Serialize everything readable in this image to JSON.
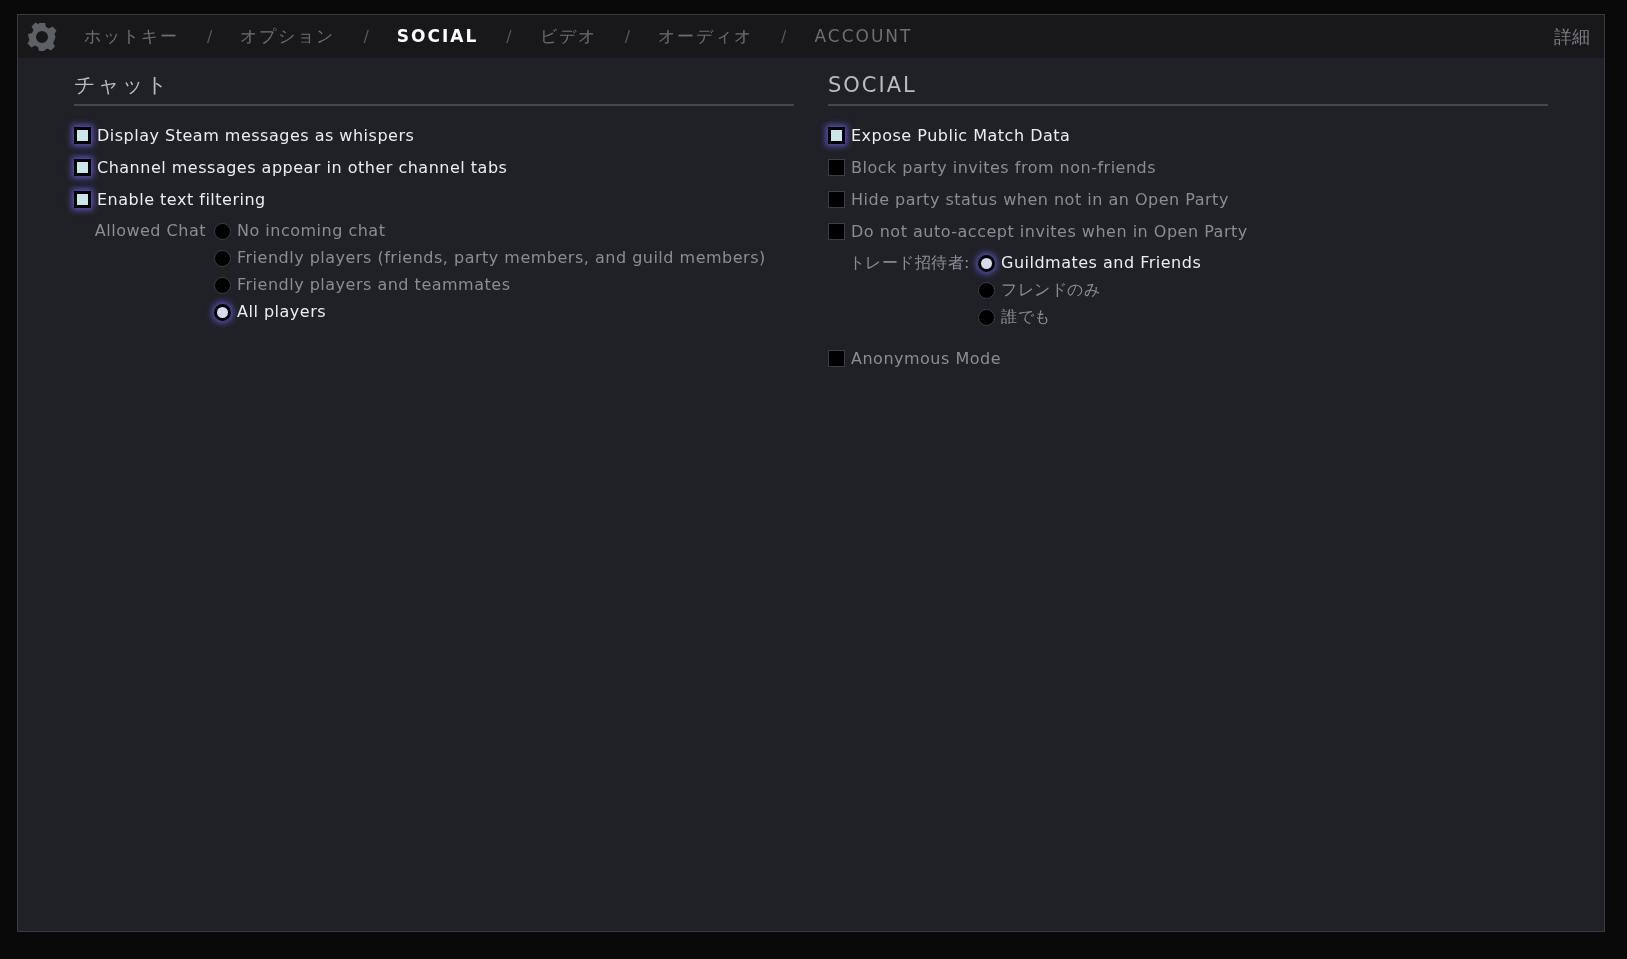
{
  "tabs": [
    {
      "label": "ホットキー",
      "selected": false
    },
    {
      "separator": "/",
      "label": "オプション",
      "selected": false
    },
    {
      "separator": "/",
      "label": "SOCIAL",
      "selected": true
    },
    {
      "separator": "/",
      "label": "ビデオ",
      "selected": false
    },
    {
      "separator": "/",
      "label": "オーディオ",
      "selected": false
    },
    {
      "separator": "/",
      "label": "ACCOUNT",
      "selected": false
    }
  ],
  "advanced_link": "詳細",
  "sections": [
    {
      "title": "チャット",
      "items": [
        {
          "kind": "checkbox",
          "label": "Display Steam messages as whispers",
          "checked": true
        },
        {
          "kind": "checkbox",
          "label": "Channel messages appear in other channel tabs",
          "checked": true
        },
        {
          "kind": "checkbox",
          "label": "Enable text filtering",
          "checked": true
        },
        {
          "kind": "radio_group",
          "label": "Allowed Chat",
          "options": [
            {
              "label": "No incoming chat",
              "selected": false
            },
            {
              "label": "Friendly players (friends, party members, and guild members)",
              "selected": false
            },
            {
              "label": "Friendly players and teammates",
              "selected": false
            },
            {
              "label": "All players",
              "selected": true
            }
          ]
        }
      ]
    },
    {
      "title": "SOCIAL",
      "items": [
        {
          "kind": "checkbox",
          "label": "Expose Public Match Data",
          "checked": true
        },
        {
          "kind": "checkbox",
          "label": "Block party invites from non-friends",
          "checked": false
        },
        {
          "kind": "checkbox",
          "label": "Hide party status when not in an Open Party",
          "checked": false
        },
        {
          "kind": "checkbox",
          "label": "Do not auto-accept invites when in Open Party",
          "checked": false
        },
        {
          "kind": "radio_group",
          "label": "トレード招待者:",
          "options": [
            {
              "label": "Guildmates and Friends",
              "selected": true
            },
            {
              "label": "フレンドのみ",
              "selected": false
            },
            {
              "label": "誰でも",
              "selected": false
            }
          ]
        },
        {
          "kind": "checkbox",
          "label": "Anonymous Mode",
          "checked": false
        }
      ]
    }
  ]
}
